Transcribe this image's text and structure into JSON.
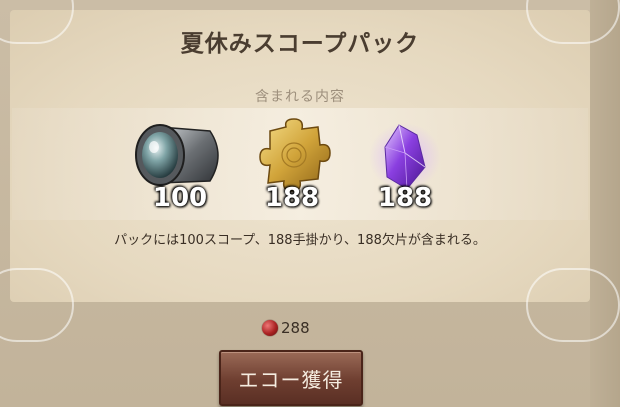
{
  "pack": {
    "title": "夏休みスコープパック",
    "contents_label": "含まれる内容",
    "items": [
      {
        "icon": "scope-icon",
        "count": "100"
      },
      {
        "icon": "puzzle-piece-icon",
        "count": "188"
      },
      {
        "icon": "crystal-shard-icon",
        "count": "188"
      }
    ],
    "description": "パックには100スコープ、188手掛かり、188欠片が含まれる。"
  },
  "cost": {
    "icon": "echo-gem-icon",
    "value": "288",
    "gem_color": "#a22222"
  },
  "purchase_button": {
    "label": "エコー獲得"
  },
  "colors": {
    "panel": "#e8dcc4",
    "title": "#4a3d30",
    "button": "#6e3e30"
  }
}
